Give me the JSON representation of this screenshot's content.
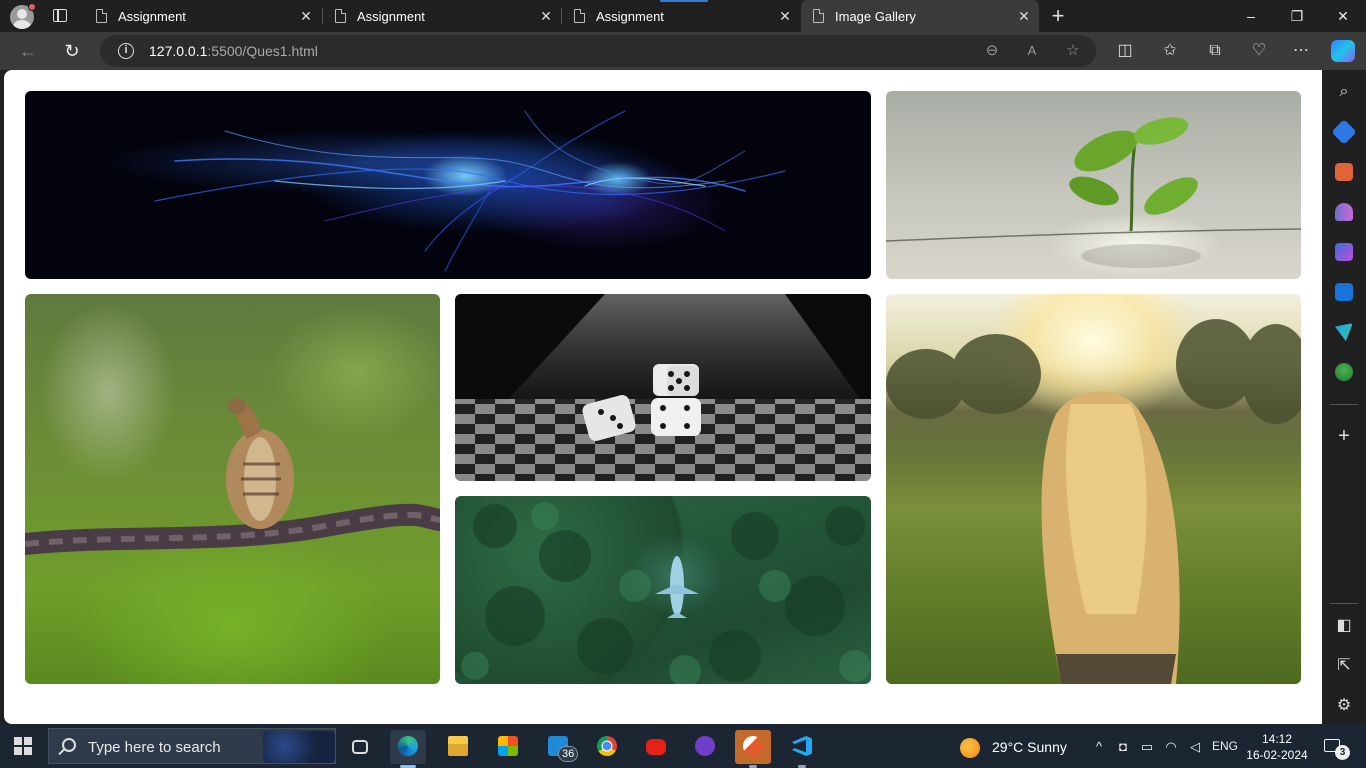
{
  "browser": {
    "tabs": [
      {
        "label": "Assignment",
        "active": false
      },
      {
        "label": "Assignment",
        "active": false
      },
      {
        "label": "Assignment",
        "active": false
      },
      {
        "label": "Image Gallery",
        "active": true
      }
    ],
    "url_host": "127.0.0.1",
    "url_rest": ":5500/Ques1.html",
    "window_controls": {
      "minimize": "–",
      "maximize": "❐",
      "close": "✕"
    }
  },
  "gallery": {
    "images": [
      {
        "subject": "abstract blue light fibers"
      },
      {
        "subject": "seedling growing from concrete"
      },
      {
        "subject": "squirrel on twisted rope"
      },
      {
        "subject": "dice on chessboard"
      },
      {
        "subject": "airplane over forest"
      },
      {
        "subject": "girl in sunlit field"
      }
    ]
  },
  "taskbar": {
    "search_placeholder": "Type here to search",
    "mail_badge": "36",
    "weather": "29°C  Sunny",
    "language": "ENG",
    "time": "14:12",
    "date": "16-02-2024",
    "notification_count": "3"
  },
  "colors": {
    "chrome_dark": "#202020",
    "toolbar": "#3b3b3b",
    "taskbar": "#1c2633",
    "page_bg": "#ffffff"
  }
}
